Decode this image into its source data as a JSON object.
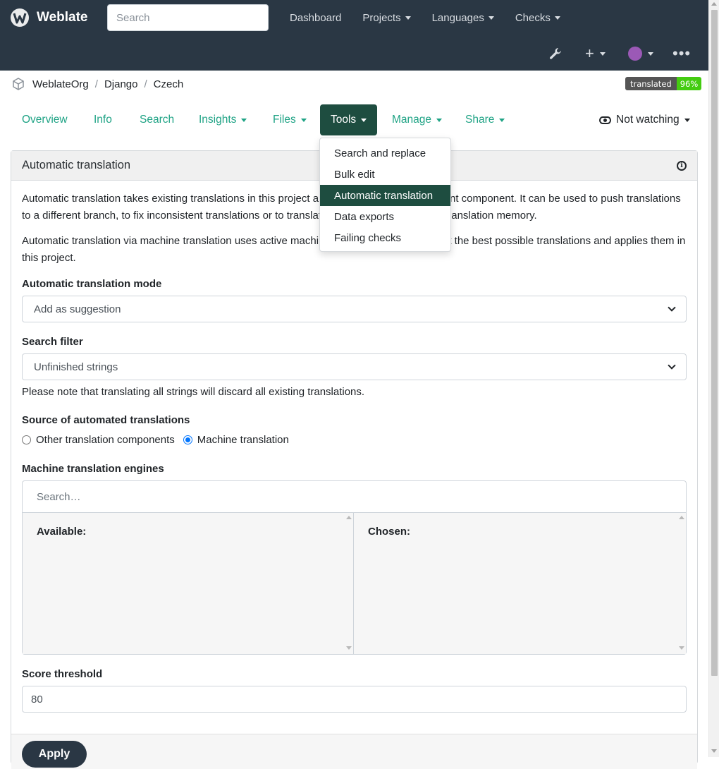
{
  "brand": {
    "name": "Weblate"
  },
  "navbar": {
    "search_placeholder": "Search",
    "links": [
      "Dashboard",
      "Projects",
      "Languages",
      "Checks"
    ],
    "tools": {
      "wrench": "wrench-icon",
      "plus": "+",
      "more": "•••"
    }
  },
  "breadcrumb": [
    "WeblateOrg",
    "Django",
    "Czech"
  ],
  "badge": {
    "label": "translated",
    "value": "96%"
  },
  "tabs": [
    "Overview",
    "Info",
    "Search",
    "Insights",
    "Files",
    "Tools",
    "Manage",
    "Share"
  ],
  "watch": {
    "label": "Not watching"
  },
  "dropdown": {
    "items": [
      "Search and replace",
      "Bulk edit",
      "Automatic translation",
      "Data exports",
      "Failing checks"
    ],
    "active": "Automatic translation"
  },
  "panel": {
    "title": "Automatic translation",
    "p1": "Automatic translation takes existing translations in this project and applies them to the current component. It can be used to push translations to a different branch, to fix inconsistent translations or to translate a new component using translation memory.",
    "p2": "Automatic translation via machine translation uses active machine translation engines to get the best possible translations and applies them in this project.",
    "mode_label": "Automatic translation mode",
    "mode_value": "Add as suggestion",
    "filter_label": "Search filter",
    "filter_value": "Unfinished strings",
    "filter_note": "Please note that translating all strings will discard all existing translations.",
    "source_label": "Source of automated translations",
    "source_options": [
      "Other translation components",
      "Machine translation"
    ],
    "source_selected": "Machine translation",
    "engines_label": "Machine translation engines",
    "engines_search": "Search…",
    "engines_available": "Available:",
    "engines_chosen": "Chosen:",
    "threshold_label": "Score threshold",
    "threshold_value": "80",
    "apply_label": "Apply"
  },
  "colors": {
    "navbar": "#2a3744",
    "accent": "#1e4d40",
    "tab_text": "#1fa385",
    "badge_green": "#44cc11"
  }
}
